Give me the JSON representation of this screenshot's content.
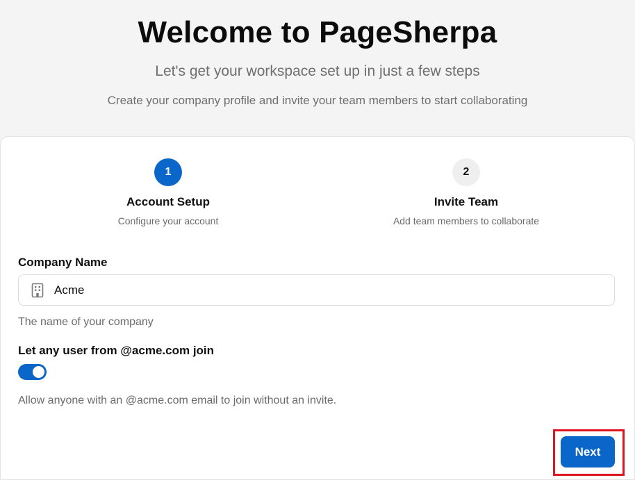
{
  "header": {
    "title": "Welcome to PageSherpa",
    "subtitle": "Let's get your workspace set up in just a few steps",
    "description": "Create your company profile and invite your team members to start collaborating"
  },
  "steps": [
    {
      "number": "1",
      "title": "Account Setup",
      "subtitle": "Configure your account",
      "state": "active"
    },
    {
      "number": "2",
      "title": "Invite Team",
      "subtitle": "Add team members to collaborate",
      "state": "inactive"
    }
  ],
  "form": {
    "company_label": "Company Name",
    "company_value": "Acme",
    "company_icon": "building-icon",
    "company_helper": "The name of your company",
    "join_label": "Let any user from @acme.com join",
    "join_enabled": true,
    "join_helper": "Allow anyone with an @acme.com email to join without an invite."
  },
  "actions": {
    "next_label": "Next"
  },
  "colors": {
    "accent": "#0a66c8",
    "highlight": "#e0141f"
  }
}
